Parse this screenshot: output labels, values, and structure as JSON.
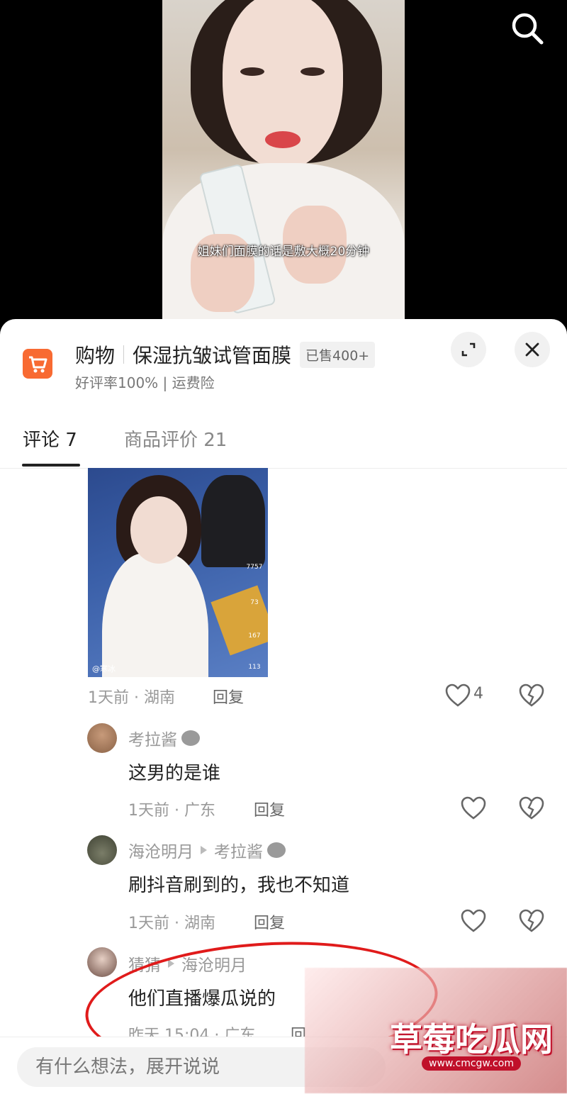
{
  "video": {
    "subtitle": "姐妹们面膜的话是敷大概20分钟"
  },
  "product": {
    "shop_label": "购物",
    "name": "保湿抗皱试管面膜",
    "sold_badge": "已售400+",
    "rating_line": "好评率100% | 运费险"
  },
  "tabs": [
    {
      "label": "评论 7",
      "active": true
    },
    {
      "label": "商品评价 21",
      "active": false
    }
  ],
  "thumbnail": {
    "likes": "7757",
    "comments": "73",
    "stars": "167",
    "shares": "113",
    "tag": "@寒冰"
  },
  "first_comment_meta": {
    "time_location": "1天前 · 湖南",
    "reply_label": "回复",
    "like_count": "4"
  },
  "replies": [
    {
      "user": "考拉酱",
      "reply_to": "",
      "text": "这男的是谁",
      "time_location": "1天前 · 广东",
      "reply_label": "回复"
    },
    {
      "user": "海沧明月",
      "reply_to": "考拉酱",
      "text": "刷抖音刷到的，我也不知道",
      "time_location": "1天前 · 湖南",
      "reply_label": "回复"
    },
    {
      "user": "猜猜",
      "reply_to": "海沧明月",
      "text": "他们直播爆瓜说的",
      "time_location": "昨天 15:04 · 广东",
      "reply_label": "回"
    }
  ],
  "input": {
    "placeholder": "有什么想法，展开说说"
  },
  "watermark": {
    "title": "草莓吃瓜网",
    "url": "www.cmcgw.com"
  },
  "colors": {
    "cart_orange": "#f86a32",
    "annotation_red": "#e01b1b"
  }
}
